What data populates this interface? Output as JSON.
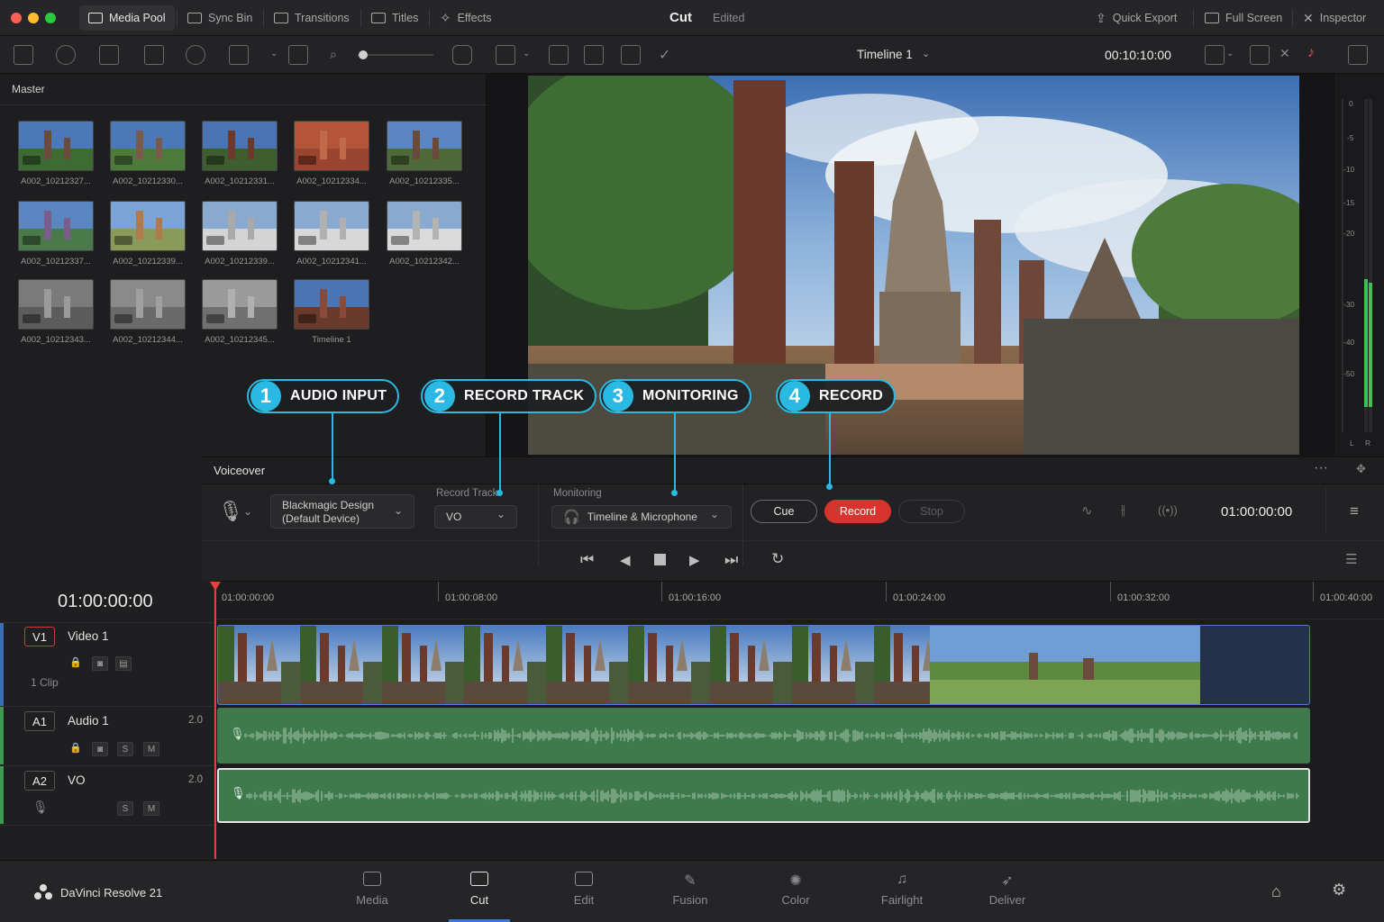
{
  "titlebar": {
    "buttons": [
      "Media Pool",
      "Sync Bin",
      "Transitions",
      "Titles",
      "Effects"
    ],
    "page_name": "Cut",
    "status": "Edited",
    "right_buttons": [
      "Quick Export",
      "Full Screen",
      "Inspector"
    ]
  },
  "toolbar": {
    "timeline_name": "Timeline 1",
    "timecode": "00:10:10:00"
  },
  "media_pool": {
    "bin": "Master",
    "clips": [
      "A002_10212327...",
      "A002_10212330...",
      "A002_10212331...",
      "A002_10212334...",
      "A002_10212335...",
      "A002_10212337...",
      "A002_10212339...",
      "A002_10212339...",
      "A002_10212341...",
      "A002_10212342...",
      "A002_10212343...",
      "A002_10212344...",
      "A002_10212345...",
      "Timeline 1"
    ]
  },
  "meter": {
    "labels": [
      "0",
      "-5",
      "-10",
      "-15",
      "-20",
      "-30",
      "-40",
      "-50"
    ],
    "channels": [
      "L",
      "R"
    ]
  },
  "callouts": [
    {
      "num": "1",
      "label": "AUDIO INPUT"
    },
    {
      "num": "2",
      "label": "RECORD TRACK"
    },
    {
      "num": "3",
      "label": "MONITORING"
    },
    {
      "num": "4",
      "label": "RECORD"
    }
  ],
  "voiceover": {
    "title": "Voiceover",
    "device_line1": "Blackmagic Design",
    "device_line2": "(Default Device)",
    "record_track_label": "Record Track",
    "record_track_value": "VO",
    "monitoring_label": "Monitoring",
    "monitoring_value": "Timeline & Microphone",
    "cue": "Cue",
    "record": "Record",
    "stop": "Stop",
    "timecode": "01:00:00:00"
  },
  "timeline": {
    "timecode": "01:00:00:00",
    "ruler": [
      "01:00:00:00",
      "01:00:08:00",
      "01:00:16:00",
      "01:00:24:00",
      "01:00:32:00",
      "01:00:40:00"
    ],
    "tracks": [
      {
        "id": "V1",
        "name": "Video 1",
        "info": "1 Clip"
      },
      {
        "id": "A1",
        "name": "Audio 1",
        "level": "2.0"
      },
      {
        "id": "A2",
        "name": "VO",
        "level": "2.0"
      }
    ],
    "solo": "S",
    "mute": "M"
  },
  "nav": {
    "app": "DaVinci Resolve 21",
    "pages": [
      "Media",
      "Cut",
      "Edit",
      "Fusion",
      "Color",
      "Fairlight",
      "Deliver"
    ]
  },
  "colors": {
    "accent": "#29b9e2",
    "record": "#d6342e",
    "audio_clip": "#3f7a4c",
    "playhead": "#e0413b"
  }
}
